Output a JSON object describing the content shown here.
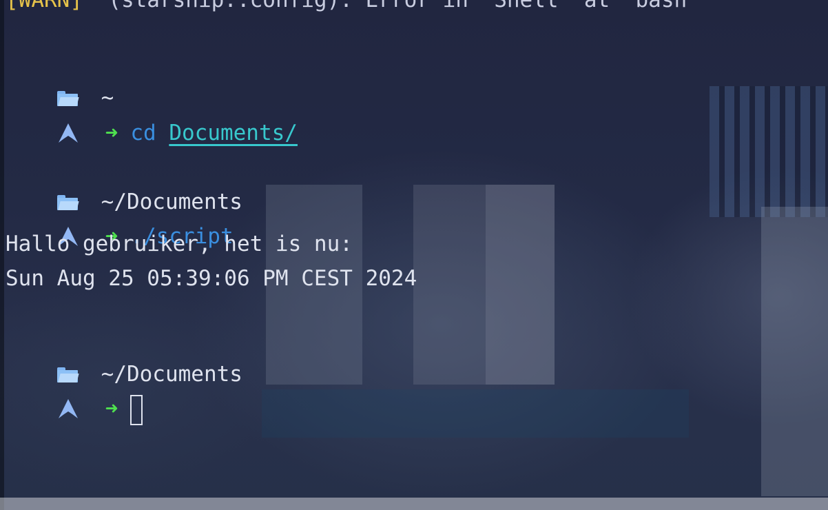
{
  "terminal": {
    "warn_tag": "[WARN]",
    "warn_message": "  (starship::config): Error in 'Shell' at 'bash'",
    "prompt_arrow": "➜",
    "blocks": [
      {
        "path": "~",
        "command": "cd",
        "argument": "Documents/"
      },
      {
        "path": "~/Documents",
        "command": "./script"
      },
      {
        "path": "~/Documents"
      }
    ],
    "output": [
      "Hallo gebruiker, het is nu:",
      "Sun Aug 25 05:39:06 PM CEST 2024"
    ],
    "icons": {
      "folder": "folder-open-icon",
      "prompt_logo": "arch-linux-icon"
    },
    "colors": {
      "warn": "#e6c34a",
      "arrow": "#4fe04f",
      "command": "#3a8fe0",
      "argument": "#38c8cd",
      "folder": "#8cc0f6",
      "logo": "#93b8f4",
      "text": "#dfe3ee"
    }
  }
}
